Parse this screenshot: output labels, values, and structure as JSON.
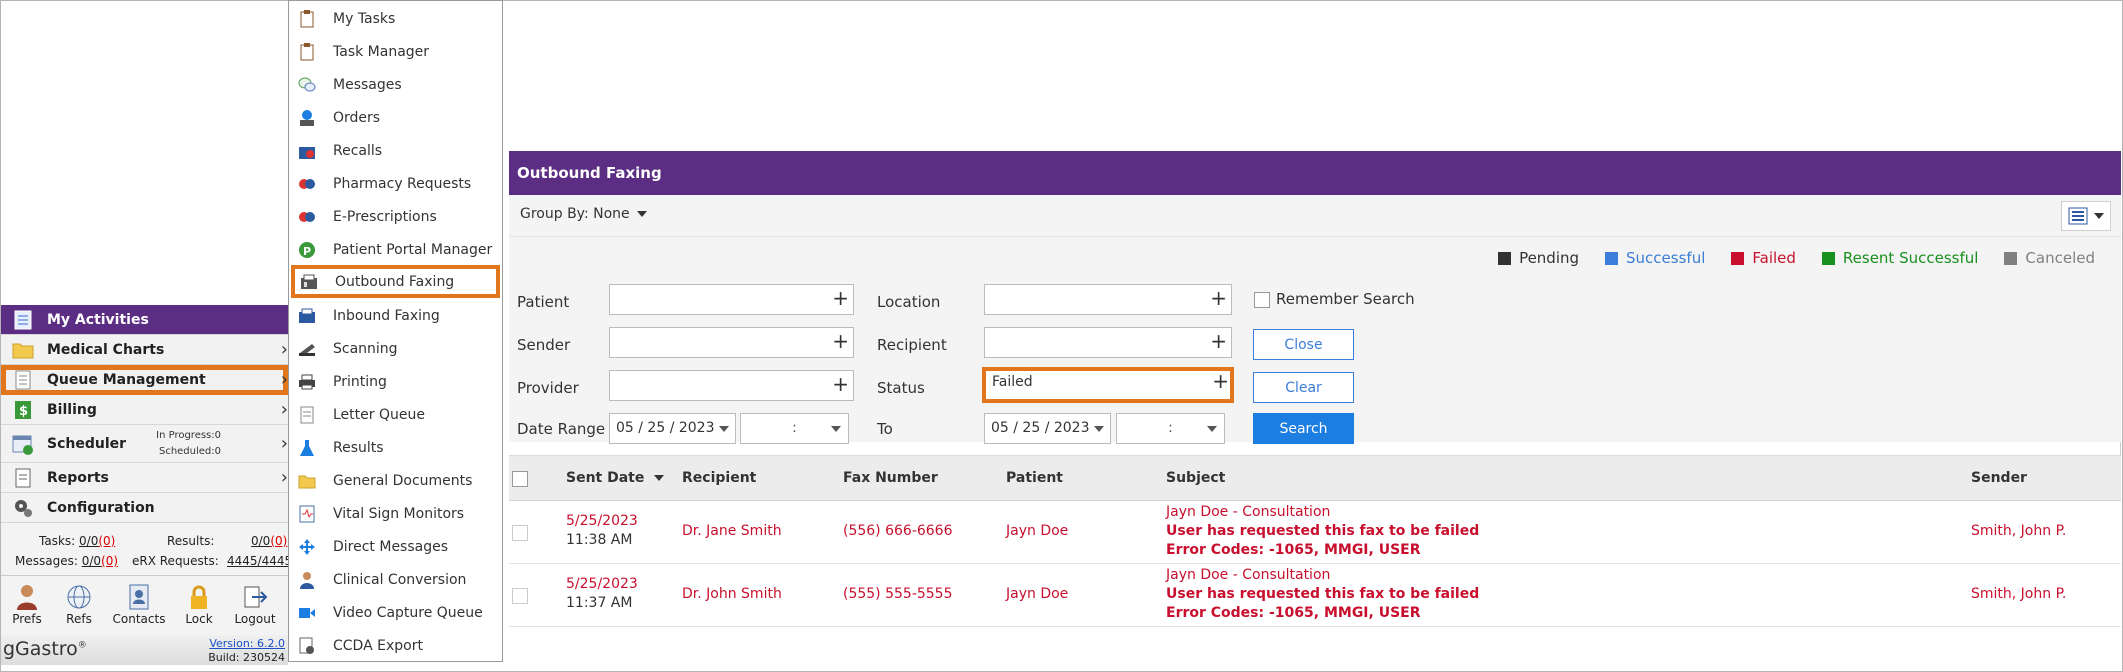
{
  "menu": {
    "items": [
      {
        "label": "My Tasks",
        "icon": "clipboard-icon"
      },
      {
        "label": "Task Manager",
        "icon": "clipboard-icon"
      },
      {
        "label": "Messages",
        "icon": "chat-bubbles-icon"
      },
      {
        "label": "Orders",
        "icon": "orders-icon"
      },
      {
        "label": "Recalls",
        "icon": "recalls-icon"
      },
      {
        "label": "Pharmacy Requests",
        "icon": "pill-icon"
      },
      {
        "label": "E-Prescriptions",
        "icon": "pill-icon"
      },
      {
        "label": "Patient Portal Manager",
        "icon": "portal-icon"
      },
      {
        "label": "Outbound Faxing",
        "icon": "fax-icon"
      },
      {
        "label": "Inbound Faxing",
        "icon": "fax-icon"
      },
      {
        "label": "Scanning",
        "icon": "scanner-icon"
      },
      {
        "label": "Printing",
        "icon": "printer-icon"
      },
      {
        "label": "Letter Queue",
        "icon": "letter-icon"
      },
      {
        "label": "Results",
        "icon": "flask-icon"
      },
      {
        "label": "General Documents",
        "icon": "folder-icon"
      },
      {
        "label": "Vital Sign Monitors",
        "icon": "monitor-icon"
      },
      {
        "label": "Direct Messages",
        "icon": "arrows-icon"
      },
      {
        "label": "Clinical Conversion",
        "icon": "person-icon"
      },
      {
        "label": "Video Capture Queue",
        "icon": "video-icon"
      },
      {
        "label": "CCDA Export",
        "icon": "export-icon"
      }
    ]
  },
  "sidebar": {
    "items": [
      {
        "label": "My Activities"
      },
      {
        "label": "Medical Charts"
      },
      {
        "label": "Queue Management"
      },
      {
        "label": "Billing"
      },
      {
        "label": "Scheduler"
      },
      {
        "label": "Reports"
      },
      {
        "label": "Configuration"
      }
    ],
    "scheduler_in_progress": "In Progress:0",
    "scheduler_scheduled": "Scheduled:0",
    "stats": {
      "tasks_label": "Tasks:",
      "tasks_value": "0/0",
      "tasks_red": "(0)",
      "results_label": "Results:",
      "results_value": "0/0",
      "results_red": "(0)",
      "messages_label": "Messages:",
      "messages_value": "0/0",
      "messages_red": "(0)",
      "erx_label": "eRX Requests:",
      "erx_value": "4445/4445"
    },
    "toolbar": [
      {
        "label": "Prefs"
      },
      {
        "label": "Refs"
      },
      {
        "label": "Contacts"
      },
      {
        "label": "Lock"
      },
      {
        "label": "Logout"
      }
    ],
    "brand": "gGastro",
    "brand_mark": "®",
    "version": "Version: 6.2.0",
    "build": "Build: 230524"
  },
  "panel": {
    "title": "Outbound Faxing",
    "group_by": "Group By: None",
    "legend": [
      {
        "label": "Pending",
        "color": "#333333"
      },
      {
        "label": "Successful",
        "color": "#3b7dd8"
      },
      {
        "label": "Failed",
        "color": "#c8102e"
      },
      {
        "label": "Resent Successful",
        "color": "#17901e"
      },
      {
        "label": "Canceled",
        "color": "#808080"
      }
    ],
    "filters": {
      "patient": "Patient",
      "location": "Location",
      "sender": "Sender",
      "recipient": "Recipient",
      "provider": "Provider",
      "status": "Status",
      "status_value": "Failed",
      "date_range": "Date Range",
      "to": "To",
      "date_from": "05 / 25 / 2023",
      "date_to": "05 / 25 / 2023",
      "time_from": ":",
      "time_to": ":",
      "remember": "Remember Search",
      "close": "Close",
      "clear": "Clear",
      "search": "Search",
      "plus": "+"
    },
    "table": {
      "headers": {
        "sent_date": "Sent Date",
        "recipient": "Recipient",
        "fax_number": "Fax Number",
        "patient": "Patient",
        "subject": "Subject",
        "sender": "Sender"
      },
      "rows": [
        {
          "date": "5/25/2023",
          "time": "11:38 AM",
          "recipient": "Dr. Jane Smith",
          "fax": "(556) 666-6666",
          "patient": "Jayn Doe",
          "subject": "Jayn Doe - Consultation",
          "subject_line2": "User has requested this fax to be failed",
          "subject_line3": "Error Codes: -1065, MMGI, USER",
          "sender": "Smith, John P."
        },
        {
          "date": "5/25/2023",
          "time": "11:37 AM",
          "recipient": "Dr. John Smith",
          "fax": "(555) 555-5555",
          "patient": "Jayn Doe",
          "subject": "Jayn Doe - Consultation",
          "subject_line2": "User has requested this fax to be failed",
          "subject_line3": "Error Codes: -1065, MMGI, USER",
          "sender": "Smith, John P."
        }
      ]
    }
  }
}
